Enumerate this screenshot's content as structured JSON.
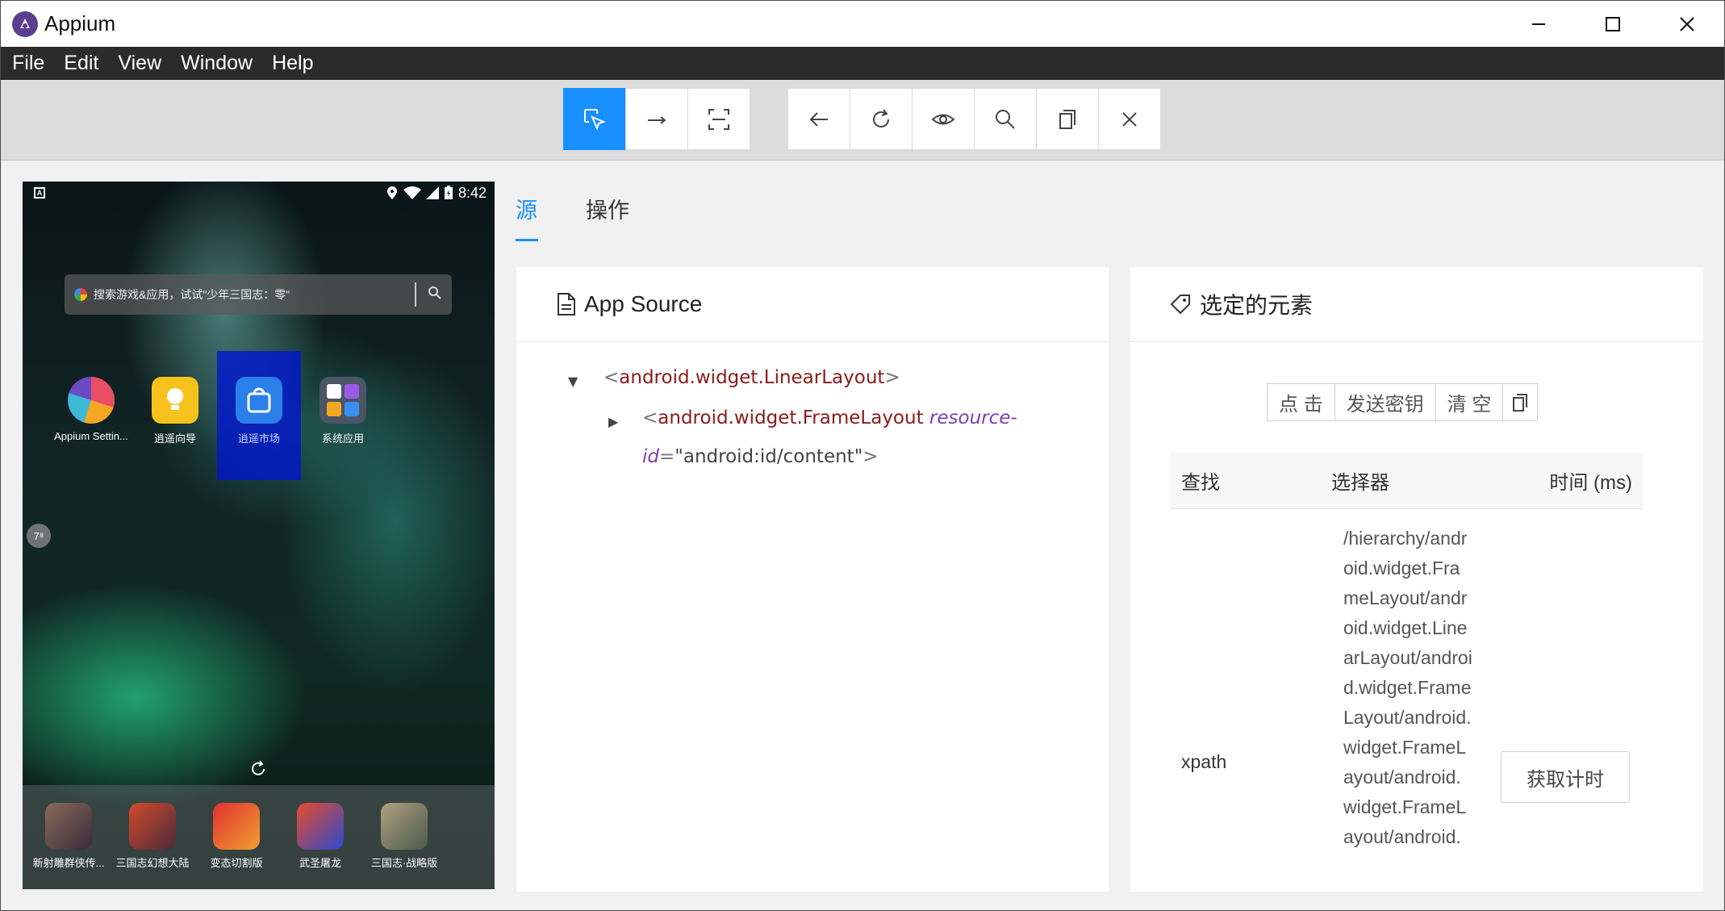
{
  "window": {
    "title": "Appium",
    "controls": {
      "minimize": "minimize",
      "maximize": "maximize",
      "close": "close"
    }
  },
  "menu": [
    "File",
    "Edit",
    "View",
    "Window",
    "Help"
  ],
  "toolbar": {
    "group1": [
      "select-elements",
      "swipe",
      "tap-by-coordinates"
    ],
    "group2": [
      "back",
      "refresh",
      "eye",
      "search",
      "copy",
      "close"
    ],
    "active": "select-elements",
    "accent_color": "#1890ff"
  },
  "device": {
    "status": {
      "left_icon": "A",
      "time": "8:42"
    },
    "search_placeholder": "搜索游戏&应用，试试\"少年三国志：零\"",
    "apps": [
      {
        "label": "Appium Settin...",
        "icon": "appium-settings-icon",
        "selected": false
      },
      {
        "label": "逍遥向导",
        "icon": "bulb-icon",
        "selected": false
      },
      {
        "label": "逍遥市场",
        "icon": "market-icon",
        "selected": true
      },
      {
        "label": "系统应用",
        "icon": "system-apps-icon",
        "selected": false
      }
    ],
    "badge": "7⁸",
    "dock": [
      {
        "label": "新射雕群侠传..."
      },
      {
        "label": "三国志幻想大陆"
      },
      {
        "label": "变态切割版"
      },
      {
        "label": "武圣屠龙"
      },
      {
        "label": "三国志·战略版"
      }
    ]
  },
  "tabs": [
    {
      "label": "源",
      "active": true
    },
    {
      "label": "操作",
      "active": false
    }
  ],
  "source_panel": {
    "title": "App Source",
    "tree": {
      "root_tag": "android.widget.LinearLayout",
      "child_tag": "android.widget.FrameLayout",
      "child_attr_name_1": "resource-",
      "child_attr_name_2": "id",
      "child_attr_value": "\"android:id/content\""
    }
  },
  "selected_panel": {
    "title": "选定的元素",
    "actions": {
      "tap": "点 击",
      "send_keys": "发送密钥",
      "clear": "清 空"
    },
    "table": {
      "headers": {
        "find": "查找",
        "selector": "选择器",
        "time": "时间 (ms)"
      },
      "row": {
        "find": "xpath",
        "selector": "/hierarchy/android.widget.FrameLayout/android.widget.LinearLayout/android.widget.FrameLayout/android.widget.FrameLayout/android.widget.FrameLayout/android.",
        "timing_button": "获取计时"
      }
    }
  }
}
